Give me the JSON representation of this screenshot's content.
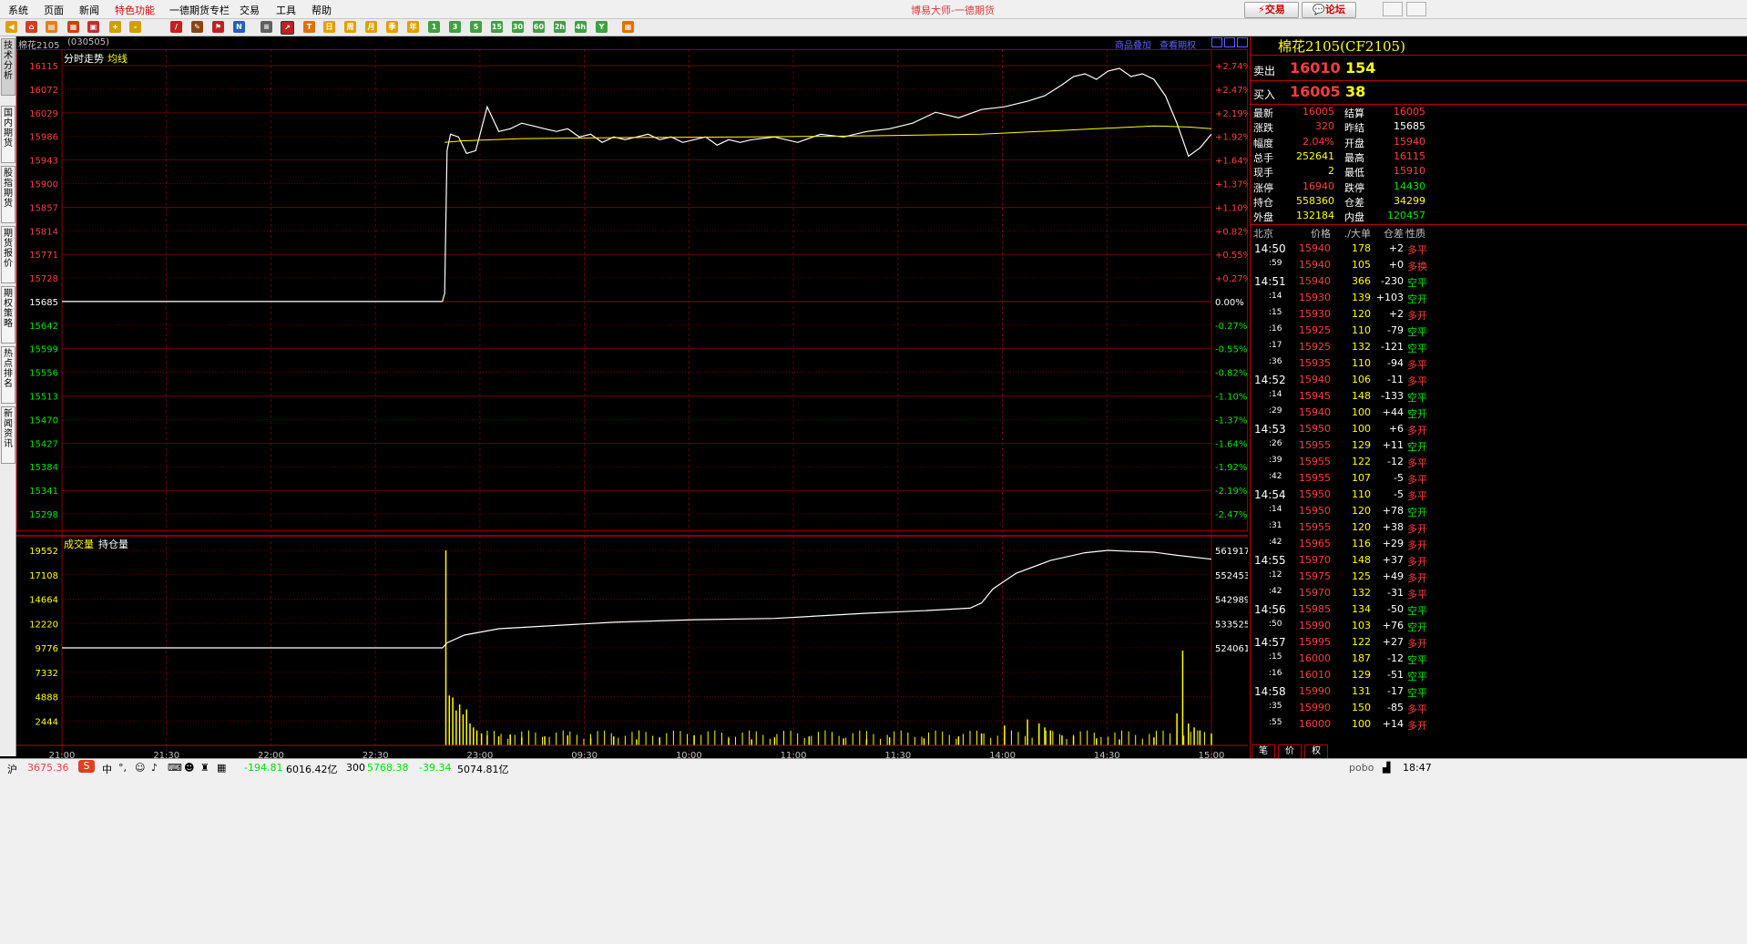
{
  "menu": [
    "系统",
    "页面",
    "新闻",
    "特色功能",
    "一德期货专栏",
    "交易",
    "工具",
    "帮助"
  ],
  "app_title": "博易大师-一德期货",
  "top_buttons": {
    "trade": "交易",
    "forum": "论坛"
  },
  "toolbar_icons": [
    "back-icon",
    "home-icon",
    "folder-icon",
    "news-icon",
    "layout-icon",
    "zoom-in-icon",
    "zoom-out-icon",
    "draw-icon",
    "brush-icon",
    "flag-icon",
    "new-icon",
    "table-icon",
    "trend-icon",
    "tick-icon",
    "day-icon",
    "week-icon",
    "month-icon",
    "season-icon",
    "year-icon",
    "min1-icon",
    "min3-icon",
    "min5-icon",
    "min15-icon",
    "min30-icon",
    "min60-icon",
    "min2h-icon",
    "min4h-icon",
    "custom-icon",
    "calc-icon"
  ],
  "toolbar_labels": [
    "日",
    "周",
    "月",
    "季",
    "年",
    "1",
    "3",
    "5",
    "15",
    "30",
    "60",
    "2h",
    "4h",
    "Y"
  ],
  "left_tabs": [
    "技术分析",
    "国内期货",
    "股指期货",
    "期货报价",
    "期权策略",
    "热点排名",
    "新闻资讯"
  ],
  "chart_header": {
    "symbol": "棉花2105",
    "code": "(030505)",
    "link1": "商品叠加",
    "link2": "查看期权"
  },
  "colors": {
    "price": "#ffffff",
    "avg": "#ffff00",
    "grid": "#8b0000",
    "volume": "#ffff00",
    "up": "#ff3c3c",
    "down": "#00e600"
  },
  "chart_data": [
    {
      "type": "line",
      "title": "分时走势",
      "legend": [
        "分时走势",
        "均线"
      ],
      "prev_close": 15685,
      "ylim": [
        15298,
        16115
      ],
      "y_ticks_left": [
        16115,
        16072,
        16029,
        15986,
        15943,
        15900,
        15857,
        15814,
        15771,
        15728,
        15685,
        15642,
        15599,
        15556,
        15513,
        15470,
        15427,
        15384,
        15341,
        15298
      ],
      "y_ticks_right": [
        "+2.74%",
        "+2.47%",
        "+2.19%",
        "+1.92%",
        "+1.64%",
        "+1.37%",
        "+1.10%",
        "+0.82%",
        "+0.55%",
        "+0.27%",
        "0.00%",
        "-0.27%",
        "-0.55%",
        "-0.82%",
        "-1.10%",
        "-1.37%",
        "-1.64%",
        "-1.92%",
        "-2.19%",
        "-2.47%"
      ],
      "x_ticks": [
        "21:00",
        "21:30",
        "22:00",
        "22:30",
        "23:00",
        "09:30",
        "10:00",
        "11:00",
        "11:30",
        "14:00",
        "14:30",
        "15:00"
      ],
      "series": [
        {
          "name": "分时走势",
          "x": [
            0,
            0.331,
            0.333,
            0.335,
            0.338,
            0.345,
            0.352,
            0.36,
            0.37,
            0.38,
            0.39,
            0.4,
            0.41,
            0.42,
            0.43,
            0.44,
            0.45,
            0.46,
            0.47,
            0.48,
            0.49,
            0.5,
            0.51,
            0.52,
            0.53,
            0.54,
            0.55,
            0.56,
            0.57,
            0.58,
            0.59,
            0.6,
            0.62,
            0.64,
            0.66,
            0.68,
            0.7,
            0.72,
            0.74,
            0.76,
            0.78,
            0.8,
            0.82,
            0.84,
            0.855,
            0.87,
            0.88,
            0.89,
            0.9,
            0.91,
            0.92,
            0.93,
            0.94,
            0.95,
            0.96,
            0.97,
            0.975,
            0.98,
            0.99,
            1.0
          ],
          "y": [
            15685,
            15685,
            15700,
            15960,
            15990,
            15985,
            15955,
            15960,
            16040,
            15995,
            16000,
            16010,
            16005,
            16000,
            15995,
            16000,
            15985,
            15990,
            15975,
            15985,
            15980,
            15985,
            15990,
            15980,
            15985,
            15975,
            15980,
            15985,
            15970,
            15980,
            15975,
            15980,
            15985,
            15975,
            15990,
            15985,
            15995,
            16000,
            16010,
            16030,
            16020,
            16035,
            16040,
            16050,
            16060,
            16080,
            16095,
            16100,
            16090,
            16105,
            16110,
            16095,
            16100,
            16090,
            16060,
            16010,
            15980,
            15950,
            15965,
            15990
          ]
        },
        {
          "name": "均线",
          "x": [
            0.333,
            0.35,
            0.4,
            0.5,
            0.6,
            0.7,
            0.8,
            0.85,
            0.9,
            0.95,
            0.98,
            1.0
          ],
          "y": [
            15975,
            15978,
            15982,
            15984,
            15985,
            15987,
            15990,
            15995,
            16000,
            16005,
            16003,
            16000
          ]
        }
      ]
    },
    {
      "type": "bar",
      "title": "成交量",
      "legend": [
        "成交量",
        "持仓量"
      ],
      "y_ticks_left": [
        19552,
        17108,
        14664,
        12220,
        9776,
        7332,
        4888,
        2444
      ],
      "y_ticks_right": [
        561917,
        552453,
        542989,
        533525,
        524061
      ],
      "volume": {
        "x": [
          0.334,
          0.337,
          0.34,
          0.343,
          0.346,
          0.349,
          0.352,
          0.355,
          0.358,
          0.361,
          0.365,
          0.37,
          0.38,
          0.39,
          0.4,
          0.42,
          0.44,
          0.46,
          0.48,
          0.5,
          0.52,
          0.55,
          0.58,
          0.6,
          0.62,
          0.65,
          0.68,
          0.7,
          0.72,
          0.75,
          0.78,
          0.8,
          0.82,
          0.84,
          0.85,
          0.855,
          0.86,
          0.87,
          0.88,
          0.9,
          0.92,
          0.95,
          0.97,
          0.975,
          0.98,
          0.985,
          0.99,
          1.0
        ],
        "y": [
          19552,
          5000,
          4800,
          3500,
          4100,
          3100,
          3600,
          2200,
          1800,
          1500,
          1200,
          1000,
          900,
          1100,
          800,
          900,
          1000,
          700,
          900,
          600,
          800,
          1000,
          700,
          600,
          800,
          900,
          700,
          600,
          800,
          700,
          900,
          1200,
          2000,
          2600,
          2200,
          1800,
          1500,
          1000,
          900,
          700,
          600,
          800,
          3200,
          9500,
          2200,
          1800,
          1500,
          1200
        ]
      },
      "open_interest": {
        "x": [
          0,
          0.331,
          0.335,
          0.35,
          0.38,
          0.42,
          0.48,
          0.55,
          0.62,
          0.7,
          0.75,
          0.79,
          0.8,
          0.81,
          0.83,
          0.86,
          0.89,
          0.91,
          0.93,
          0.95,
          0.97,
          1.0
        ],
        "y": [
          524061,
          524061,
          526000,
          529000,
          531500,
          532500,
          534000,
          535000,
          535500,
          537500,
          538500,
          539500,
          541500,
          547000,
          553000,
          558000,
          561000,
          561917,
          561500,
          561200,
          560000,
          558500
        ]
      }
    }
  ],
  "quote": {
    "title": "棉花2105(CF2105)",
    "sell_label": "卖出",
    "sell_price": "16010",
    "sell_vol": "154",
    "buy_label": "买入",
    "buy_price": "16005",
    "buy_vol": "38",
    "rows": [
      [
        "最新",
        "16005",
        "结算",
        "16005"
      ],
      [
        "涨跌",
        "320",
        "昨结",
        "15685"
      ],
      [
        "幅度",
        "2.04%",
        "开盘",
        "15940"
      ],
      [
        "总手",
        "252641",
        "最高",
        "16115"
      ],
      [
        "现手",
        "2",
        "最低",
        "15910"
      ],
      [
        "涨停",
        "16940",
        "跌停",
        "14430"
      ],
      [
        "持仓",
        "558360",
        "仓差",
        "34299"
      ],
      [
        "外盘",
        "132184",
        "内盘",
        "120457"
      ]
    ]
  },
  "ticks_header": [
    "北京",
    "价格",
    "./大单",
    "仓差",
    "性质"
  ],
  "ticks": [
    [
      "14:50",
      "15940",
      "178",
      "+2",
      "多平"
    ],
    [
      ":59",
      "15940",
      "105",
      "+0",
      "多换"
    ],
    [
      "14:51",
      "15940",
      "366",
      "-230",
      "空平"
    ],
    [
      ":14",
      "15930",
      "139",
      "+103",
      "空开"
    ],
    [
      ":15",
      "15930",
      "120",
      "+2",
      "多开"
    ],
    [
      ":16",
      "15925",
      "110",
      "-79",
      "空平"
    ],
    [
      ":17",
      "15925",
      "132",
      "-121",
      "空平"
    ],
    [
      ":36",
      "15935",
      "110",
      "-94",
      "多平"
    ],
    [
      "14:52",
      "15940",
      "106",
      "-11",
      "多平"
    ],
    [
      ":14",
      "15945",
      "148",
      "-133",
      "空平"
    ],
    [
      ":29",
      "15940",
      "100",
      "+44",
      "空开"
    ],
    [
      "14:53",
      "15950",
      "100",
      "+6",
      "多开"
    ],
    [
      ":26",
      "15955",
      "129",
      "+11",
      "空开"
    ],
    [
      ":39",
      "15955",
      "122",
      "-12",
      "多平"
    ],
    [
      ":42",
      "15955",
      "107",
      "-5",
      "多平"
    ],
    [
      "14:54",
      "15950",
      "110",
      "-5",
      "多平"
    ],
    [
      ":14",
      "15950",
      "120",
      "+78",
      "空开"
    ],
    [
      ":31",
      "15955",
      "120",
      "+38",
      "多开"
    ],
    [
      ":42",
      "15965",
      "116",
      "+29",
      "多开"
    ],
    [
      "14:55",
      "15970",
      "148",
      "+37",
      "多开"
    ],
    [
      ":12",
      "15975",
      "125",
      "+49",
      "多开"
    ],
    [
      ":42",
      "15970",
      "132",
      "-31",
      "多平"
    ],
    [
      "14:56",
      "15985",
      "134",
      "-50",
      "空平"
    ],
    [
      ":50",
      "15990",
      "103",
      "+76",
      "空开"
    ],
    [
      "14:57",
      "15995",
      "122",
      "+27",
      "多开"
    ],
    [
      ":15",
      "16000",
      "187",
      "-12",
      "空平"
    ],
    [
      ":16",
      "16010",
      "129",
      "-51",
      "空平"
    ],
    [
      "14:58",
      "15990",
      "131",
      "-17",
      "空平"
    ],
    [
      ":35",
      "15990",
      "150",
      "-85",
      "多平"
    ],
    [
      ":55",
      "16000",
      "100",
      "+14",
      "多开"
    ]
  ],
  "bottom_tabs": [
    "笔",
    "价",
    "权"
  ],
  "status": {
    "sh_label": "沪",
    "sh_value": "3675.36",
    "ime": "中",
    "change1": "-194.81",
    "amount1": "6016.42亿",
    "idx300_label": "300",
    "idx300_value": "5768.38",
    "change2": "-39.34",
    "amount2": "5074.81亿",
    "brand": "pobo",
    "time": "18:47"
  }
}
